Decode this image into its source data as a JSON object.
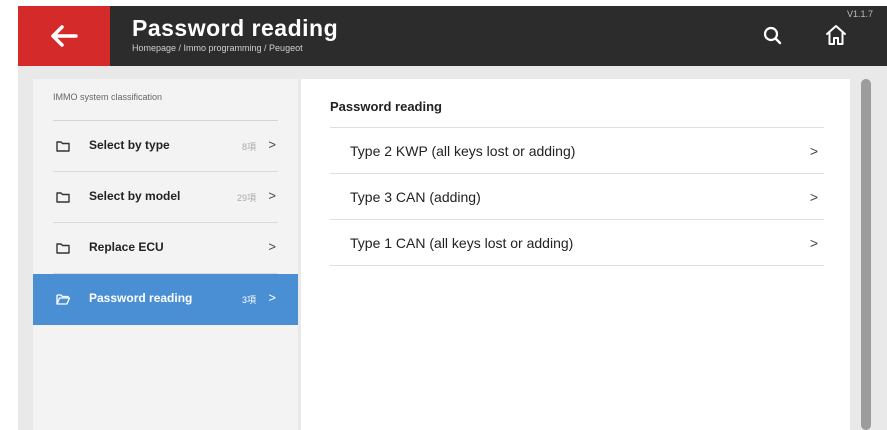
{
  "header": {
    "title": "Password reading",
    "breadcrumb": "Homepage / Immo programming / Peugeot",
    "version": "V1.1.7",
    "icons": {
      "back": "arrow-left-icon",
      "search": "search-icon",
      "home": "home-icon"
    }
  },
  "sidebar": {
    "heading": "IMMO system classification",
    "items": [
      {
        "label": "Select by type",
        "count": "8項",
        "selected": false
      },
      {
        "label": "Select by model",
        "count": "29項",
        "selected": false
      },
      {
        "label": "Replace ECU",
        "count": "",
        "selected": false
      },
      {
        "label": "Password reading",
        "count": "3項",
        "selected": true
      }
    ]
  },
  "main": {
    "title": "Password reading",
    "items": [
      {
        "label": "Type 2 KWP (all keys lost or adding)"
      },
      {
        "label": "Type 3 CAN (adding)"
      },
      {
        "label": "Type 1 CAN (all keys lost or adding)"
      }
    ]
  },
  "colors": {
    "header_bg": "#2c2c2c",
    "back_bg": "#d42a2a",
    "selected_bg": "#4a8fd4"
  }
}
